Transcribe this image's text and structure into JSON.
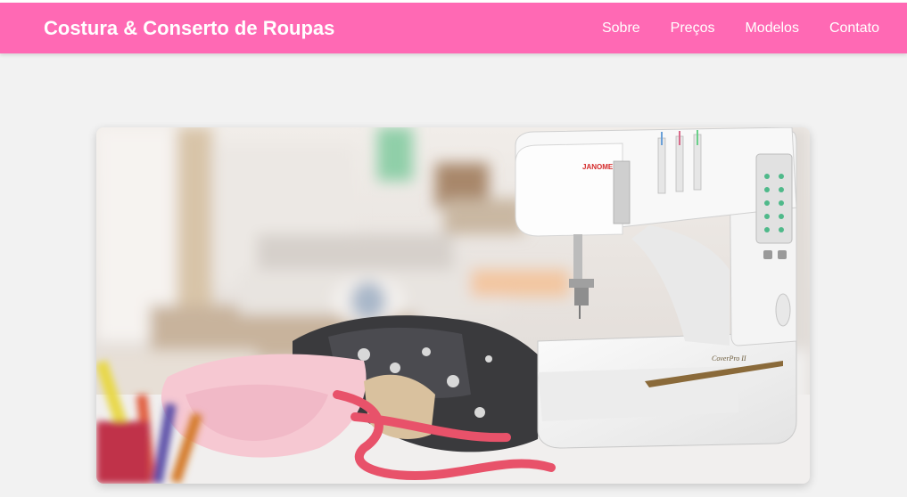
{
  "header": {
    "brand": "Costura & Conserto de Roupas",
    "nav": [
      "Sobre",
      "Preços",
      "Modelos",
      "Contato"
    ]
  },
  "hero": {
    "machine_brand": "JANOME",
    "machine_model": "CoverPro II"
  },
  "colors": {
    "header_bg": "#ff69b4",
    "page_bg": "#f2f2f2",
    "header_text": "#ffffff"
  }
}
